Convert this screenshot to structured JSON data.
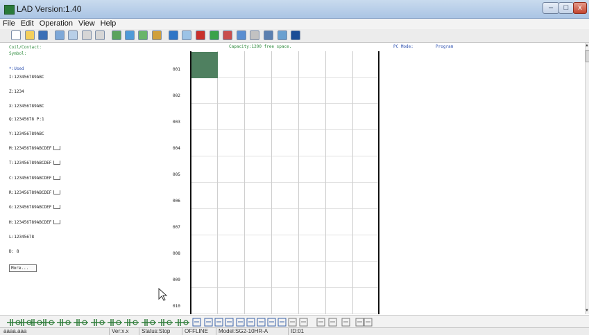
{
  "window": {
    "title": "LAD Version:1.40",
    "minimize": "–",
    "maximize": "□",
    "close": "x"
  },
  "menu": [
    "File",
    "Edit",
    "Operation",
    "View",
    "Help"
  ],
  "toolbar_icons": [
    "new-icon",
    "open-icon",
    "save-icon",
    "print-icon",
    "print-preview-icon",
    "undo-icon",
    "redo-icon",
    "compile-icon",
    "monitor-icon",
    "simulate-icon",
    "read-icon",
    "write-icon",
    "connect-icon",
    "stop-icon",
    "run-icon",
    "record-icon",
    "download-icon",
    "pause-icon",
    "upload-icon",
    "network-icon",
    "help-icon"
  ],
  "header": {
    "coil_contact": "Coil/Contact:",
    "symbol": "Symbol:",
    "capacity": "Capacity:1200 free space.",
    "pc_mode_label": "PC Mode:",
    "pc_mode_value": "Program"
  },
  "symbols": [
    {
      "text": "*:Used",
      "used": true
    },
    {
      "text": "I:123456789ABC"
    },
    {
      "text": "Z:1234"
    },
    {
      "text": "X:123456789ABC"
    },
    {
      "text": "Q:12345678  P:1"
    },
    {
      "text": "Y:123456789ABC"
    },
    {
      "text": "M:123456789ABCDEF",
      "check": true
    },
    {
      "text": "T:123456789ABCDEF",
      "check": true
    },
    {
      "text": "C:123456789ABCDEF",
      "check": true
    },
    {
      "text": "R:123456789ABCDEF",
      "check": true
    },
    {
      "text": "G:123456789ABCDEF",
      "check": true
    },
    {
      "text": "H:123456789ABCDEF",
      "check": true
    },
    {
      "text": "L:12345678"
    },
    {
      "text": "D: 8"
    }
  ],
  "more_button": "More...",
  "row_numbers": [
    "001",
    "002",
    "003",
    "004",
    "005",
    "006",
    "007",
    "008",
    "009",
    "010"
  ],
  "ladder_tools": [
    "contact-no-icon",
    "contact-nc-icon",
    "contact-p-icon",
    "coil-p-icon",
    "coil-x-icon",
    "coil-m-icon",
    "coil-t-icon",
    "coil-c-icon",
    "coil-r-icon",
    "coil-g-icon",
    "coil-h-icon",
    "coil-output-icon",
    "coil-set-icon",
    "hline-icon",
    "vline-icon",
    "add-icon",
    "mul-icon",
    "sub-icon",
    "div-icon",
    "cmp-icon",
    "and-icon",
    "or-icon",
    "delete-icon",
    "row-insert-icon",
    "row-delete-icon",
    "col-insert-icon",
    "col-delete-icon",
    "comment-icon"
  ],
  "status": {
    "file": "aaaa.aaa",
    "ver": "Ver:x.x",
    "state": "Status:Stop",
    "link": "OFFLINE",
    "model": "Model:SG2-10HR-A",
    "id": "ID:01"
  },
  "colors": {
    "accent": "#2d8a3b",
    "cursor_cell": "#4f8060",
    "pc_mode": "#2b4fb0",
    "titlebar": "#b7cde8"
  }
}
